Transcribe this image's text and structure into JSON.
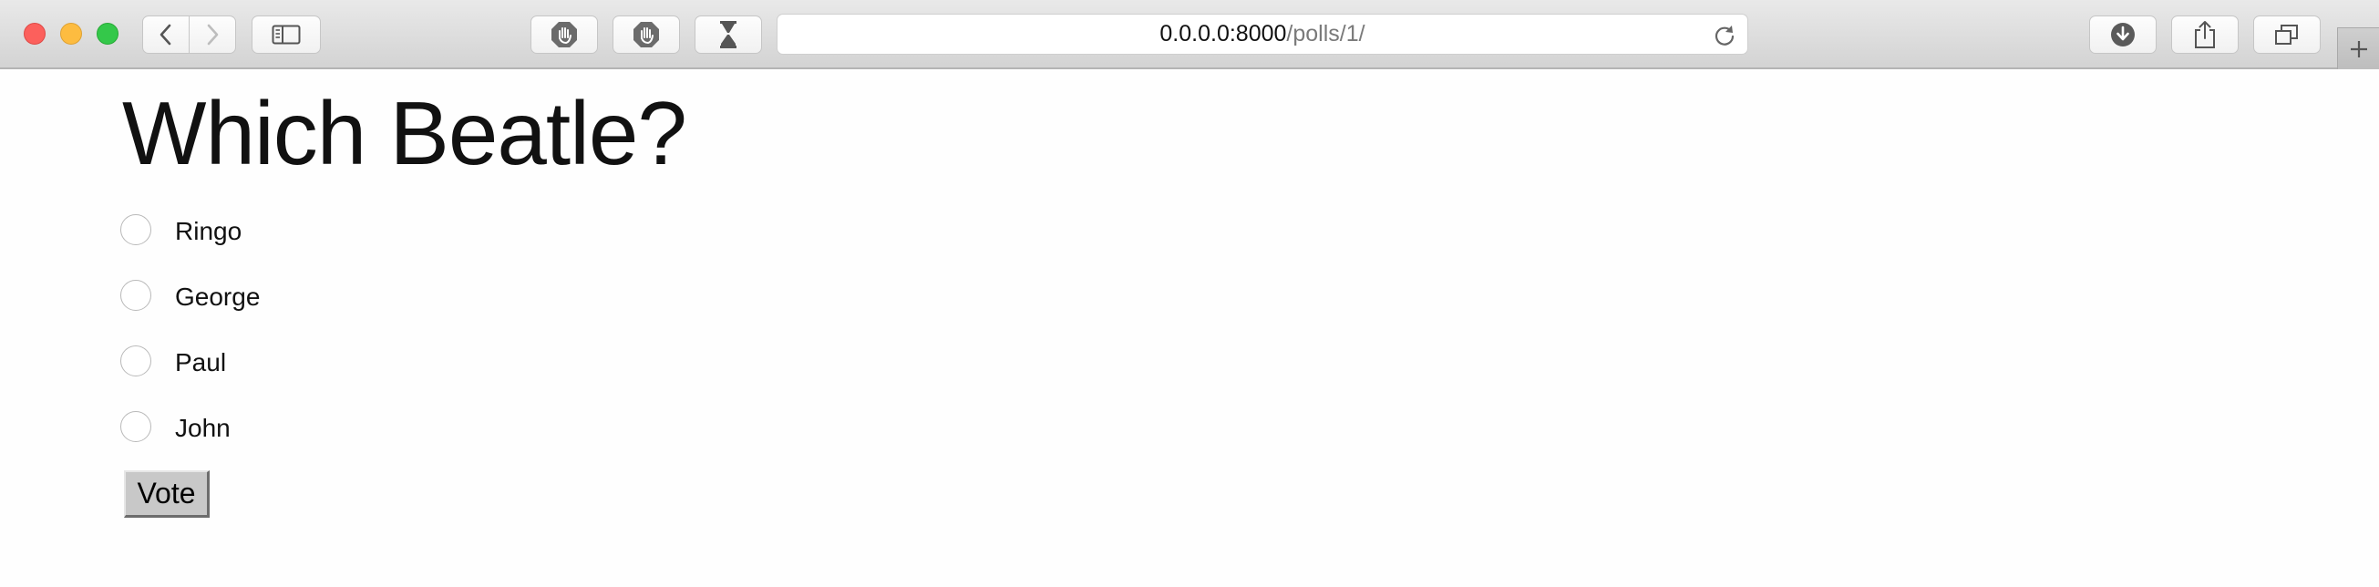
{
  "browser": {
    "url_host": "0.0.0.0:8000",
    "url_path": "/polls/1/",
    "toolbar_icons": [
      "back-icon",
      "forward-icon",
      "sidebar-icon",
      "stop-hand-icon",
      "stop-hand-icon",
      "hourglass-icon",
      "reload-icon",
      "download-icon",
      "share-icon",
      "tabs-icon",
      "plus-icon"
    ]
  },
  "poll": {
    "question": "Which Beatle?",
    "choices": [
      "Ringo",
      "George",
      "Paul",
      "John"
    ],
    "selected": null,
    "vote_label": "Vote"
  }
}
